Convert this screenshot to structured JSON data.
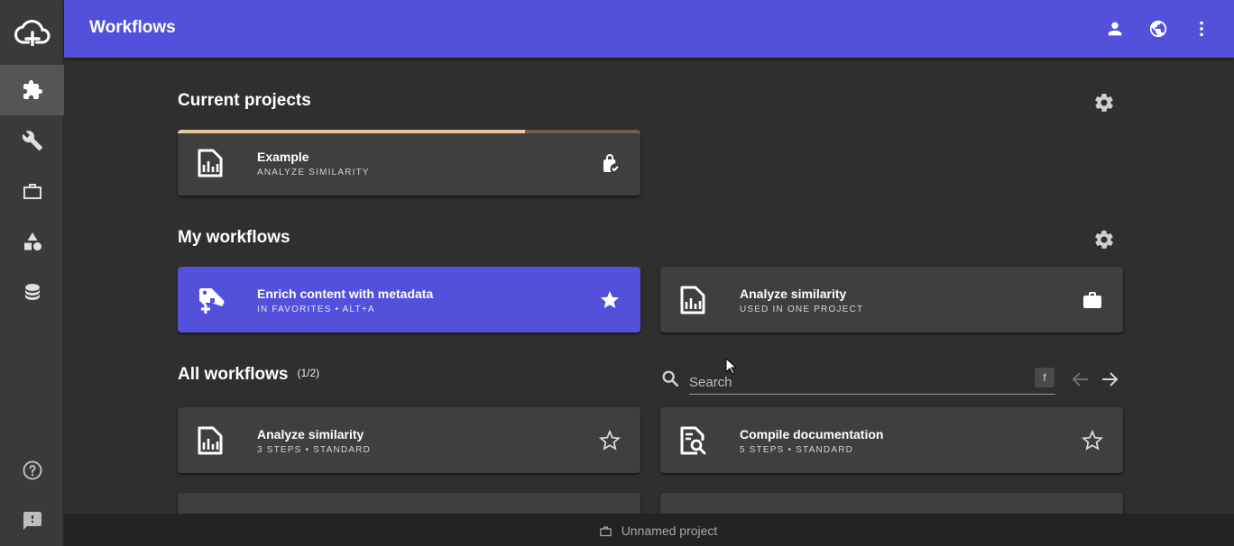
{
  "app": {
    "logo_icon": "cloud-upload-icon",
    "accent_color": "#5350dc"
  },
  "topbar": {
    "title": "Workflows",
    "actions": [
      "account-icon",
      "language-icon",
      "more-vertical-icon"
    ]
  },
  "rail": {
    "items": [
      {
        "id": "workflows",
        "icon": "puzzle-icon",
        "active": true
      },
      {
        "id": "tools",
        "icon": "wrench-icon"
      },
      {
        "id": "projects",
        "icon": "briefcase-icon"
      },
      {
        "id": "shapes",
        "icon": "shapes-icon"
      },
      {
        "id": "database",
        "icon": "database-icon"
      }
    ],
    "bottom": [
      {
        "id": "help",
        "icon": "help-circle-icon"
      },
      {
        "id": "feedback",
        "icon": "feedback-icon"
      }
    ]
  },
  "current_projects": {
    "title": "Current projects",
    "items": [
      {
        "title": "Example",
        "subtitle": "ANALYZE SIMILARITY",
        "icon": "chart-document-icon",
        "action_icon": "lock-check-icon",
        "progress": 0.75
      }
    ]
  },
  "my_workflows": {
    "title": "My workflows",
    "items": [
      {
        "title": "Enrich content with metadata",
        "subtitle": "IN FAVORITES • ALT+A",
        "icon": "tag-plus-icon",
        "action_icon": "star-filled-icon",
        "highlighted": true
      },
      {
        "title": "Analyze similarity",
        "subtitle": "USED IN ONE PROJECT",
        "icon": "chart-document-icon",
        "action_icon": "briefcase-icon"
      }
    ]
  },
  "all_workflows": {
    "title": "All workflows",
    "count": "(1/2)",
    "search": {
      "placeholder": "Search",
      "value": "",
      "shortcut": "f"
    },
    "items": [
      {
        "title": "Analyze similarity",
        "subtitle": "3 STEPS • STANDARD",
        "icon": "chart-document-icon",
        "action_icon": "star-outline-icon"
      },
      {
        "title": "Compile documentation",
        "subtitle": "5 STEPS • STANDARD",
        "icon": "document-search-icon",
        "action_icon": "star-outline-icon"
      }
    ]
  },
  "footer": {
    "project_label": "Unnamed project",
    "icon": "briefcase-outline-icon"
  }
}
